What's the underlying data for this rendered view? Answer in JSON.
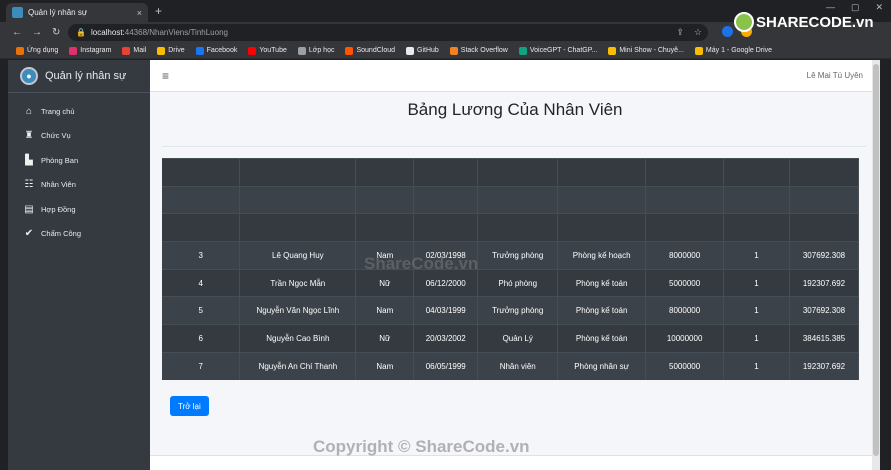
{
  "browser": {
    "tab_title": "Quản lý nhân sự",
    "tab_close": "×",
    "new_tab": "+",
    "url_host": "localhost:",
    "url_port_path": "44368/NhanViens/TinhLuong",
    "bookmarks": [
      {
        "label": "Ứng dụng",
        "color": "#e8710a"
      },
      {
        "label": "Instagram",
        "color": "#e1306c"
      },
      {
        "label": "Mail",
        "color": "#ea4335"
      },
      {
        "label": "Drive",
        "color": "#fbbc04"
      },
      {
        "label": "Facebook",
        "color": "#1877f2"
      },
      {
        "label": "YouTube",
        "color": "#ff0000"
      },
      {
        "label": "Lớp học",
        "color": "#9aa0a6"
      },
      {
        "label": "SoundCloud",
        "color": "#ff5500"
      },
      {
        "label": "GitHub",
        "color": "#e8eaed"
      },
      {
        "label": "Stack Overflow",
        "color": "#f48024"
      },
      {
        "label": "VoiceGPT - ChatGP...",
        "color": "#10a37f"
      },
      {
        "label": "Mini Show - Chuyê...",
        "color": "#fbbc04"
      },
      {
        "label": "Máy 1 - Google Drive",
        "color": "#fbbc04"
      }
    ]
  },
  "brand": {
    "name": "Quản lý nhân sự"
  },
  "sidebar": {
    "items": [
      {
        "label": "Trang chủ",
        "icon": "home-icon",
        "glyph": "⌂"
      },
      {
        "label": "Chức Vụ",
        "icon": "dumbbell-icon",
        "glyph": "♜"
      },
      {
        "label": "Phòng Ban",
        "icon": "building-icon",
        "glyph": "▙"
      },
      {
        "label": "Nhân Viên",
        "icon": "users-icon",
        "glyph": "☷"
      },
      {
        "label": "Hợp Đồng",
        "icon": "file-icon",
        "glyph": "▤"
      },
      {
        "label": "Chấm Công",
        "icon": "check-icon",
        "glyph": "✔"
      }
    ]
  },
  "topbar": {
    "user": "Lê Mai Tú Uyên",
    "menu_glyph": "≡"
  },
  "page_title": "Bảng Lương Của Nhân Viên",
  "table": {
    "rows": [
      [
        "3",
        "Lê Quang Huy",
        "Nam",
        "02/03/1998",
        "Trưởng phòng",
        "Phòng kế hoạch",
        "8000000",
        "1",
        "307692.308"
      ],
      [
        "4",
        "Trần Ngọc Mẫn",
        "Nữ",
        "06/12/2000",
        "Phó phòng",
        "Phòng kế toán",
        "5000000",
        "1",
        "192307.692"
      ],
      [
        "5",
        "Nguyễn Văn Ngọc Lĩnh",
        "Nam",
        "04/03/1999",
        "Trưởng phòng",
        "Phòng kế toán",
        "8000000",
        "1",
        "307692.308"
      ],
      [
        "6",
        "Nguyễn Cao Bình",
        "Nữ",
        "20/03/2002",
        "Quản Lý",
        "Phòng kế toán",
        "10000000",
        "1",
        "384615.385"
      ],
      [
        "7",
        "Nguyễn An Chí Thanh",
        "Nam",
        "06/05/1999",
        "Nhân viên",
        "Phòng nhân sự",
        "5000000",
        "1",
        "192307.692"
      ]
    ]
  },
  "buttons": {
    "back": "Trở lại"
  },
  "watermarks": {
    "center": "ShareCode.vn",
    "bottom": "Copyright © ShareCode.vn",
    "logo": "SHARECODE.vn"
  }
}
